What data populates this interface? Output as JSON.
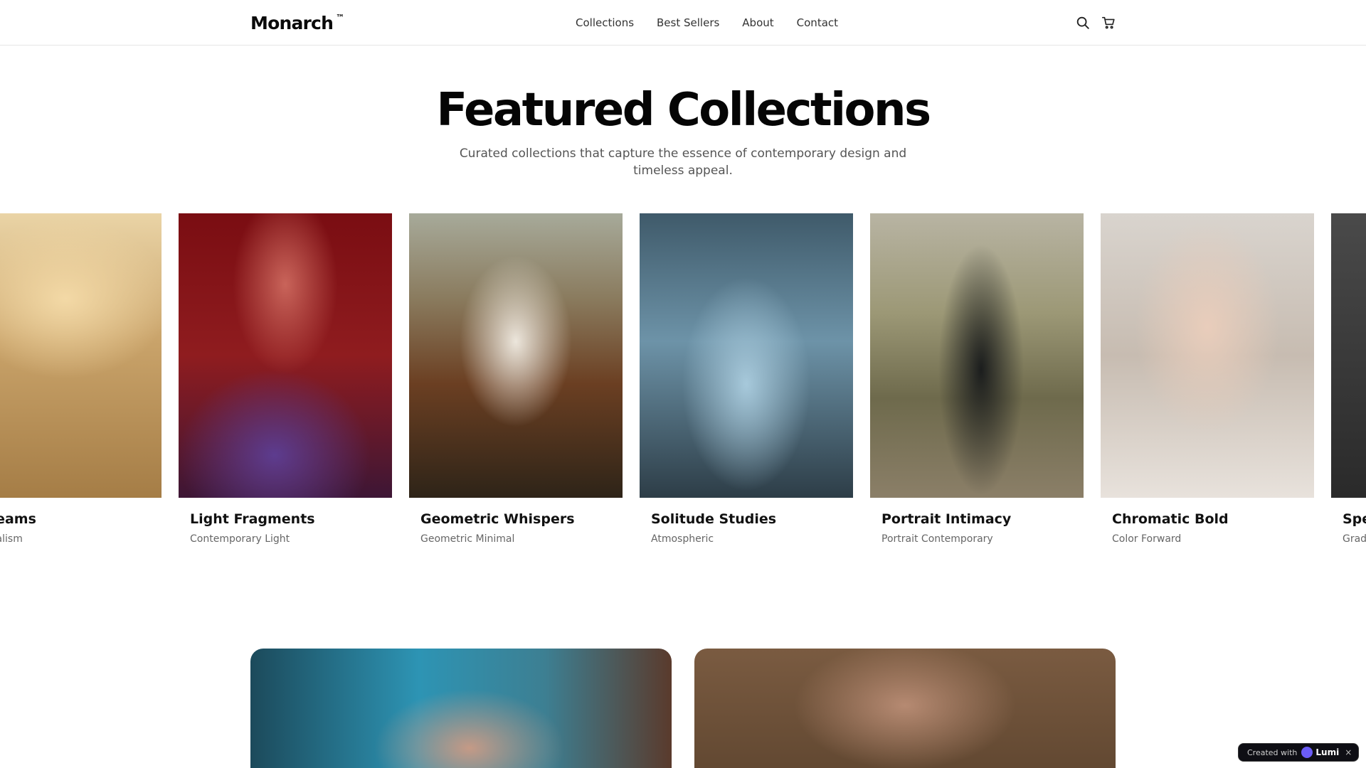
{
  "header": {
    "logo": "Monarch",
    "logo_mark": "™",
    "nav": [
      "Collections",
      "Best Sellers",
      "About",
      "Contact"
    ],
    "icons": [
      "search-icon",
      "cart-icon"
    ]
  },
  "hero": {
    "title": "Featured Collections",
    "subtitle": "Curated collections that capture the essence of contemporary design and timeless appeal."
  },
  "collections": [
    {
      "title": "al Dreams",
      "subtitle": ": Minimalism"
    },
    {
      "title": "Light Fragments",
      "subtitle": "Contemporary Light"
    },
    {
      "title": "Geometric Whispers",
      "subtitle": "Geometric Minimal"
    },
    {
      "title": "Solitude Studies",
      "subtitle": "Atmospheric"
    },
    {
      "title": "Portrait Intimacy",
      "subtitle": "Portrait Contemporary"
    },
    {
      "title": "Chromatic Bold",
      "subtitle": "Color Forward"
    },
    {
      "title": "Spe",
      "subtitle": "Grad"
    }
  ],
  "badge": {
    "prefix": "Created with",
    "brand": "Lumi",
    "close": "×"
  }
}
